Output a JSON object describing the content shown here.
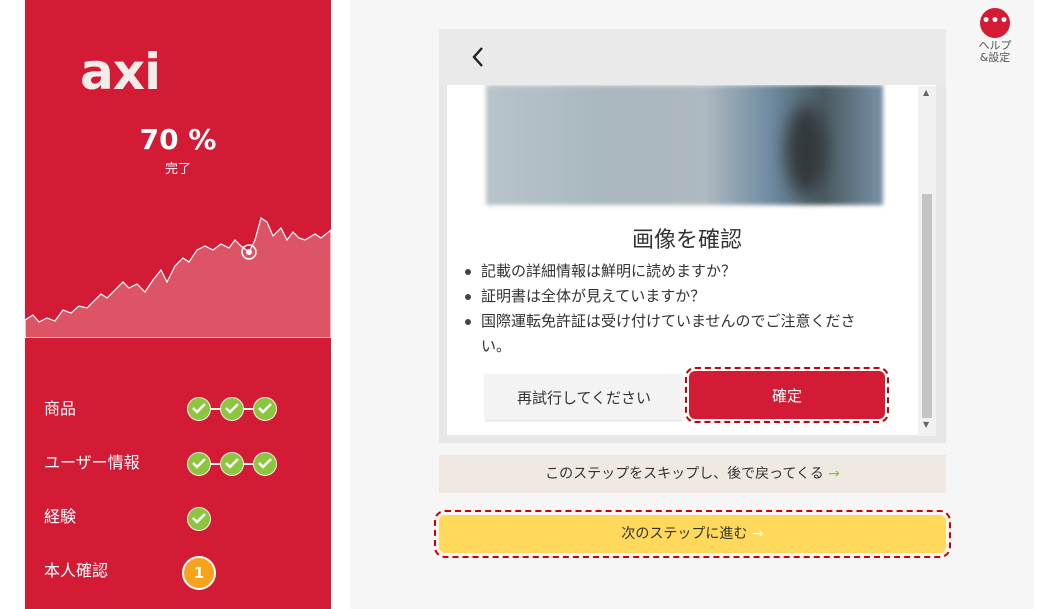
{
  "sidebar": {
    "logo": "axi",
    "progress_percent": "70 %",
    "progress_label": "完了",
    "steps": [
      {
        "label": "商品",
        "checks": 3
      },
      {
        "label": "ユーザー情報",
        "checks": 3
      },
      {
        "label": "経験",
        "checks": 1
      },
      {
        "label": "本人確認",
        "badge": "1"
      }
    ]
  },
  "help": {
    "icon": "more-icon",
    "label_line1": "ヘルプ",
    "label_line2": "&設定"
  },
  "modal": {
    "title": "画像を確認",
    "bullets": [
      "記載の詳細情報は鮮明に読めますか？",
      "証明書は全体が見えていますか？",
      "国際運転免許証は受け付けていませんのでご注意ください。"
    ],
    "retry_label": "再試行してください",
    "confirm_label": "確定"
  },
  "skip_label": "このステップをスキップし、後で戻ってくる",
  "next_label": "次のステップに進む",
  "arrow": "→",
  "colors": {
    "brand": "#d31b35",
    "check": "#8cc63f",
    "badge": "#f7a31c",
    "next": "#ffd85c"
  }
}
